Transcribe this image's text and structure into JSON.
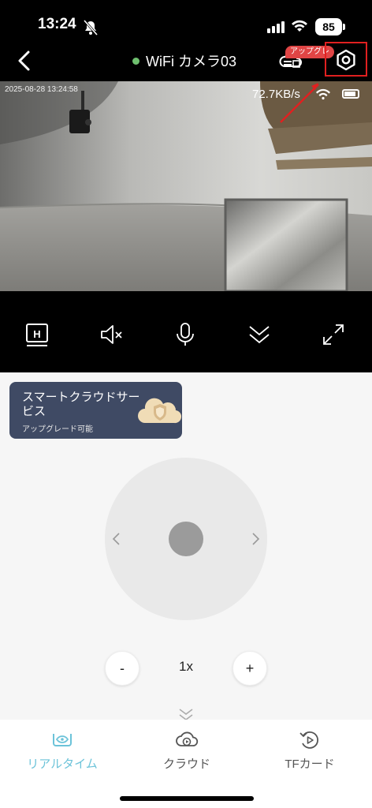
{
  "status_bar": {
    "time": "13:24",
    "battery": "85"
  },
  "header": {
    "title": "WiFi カメラ03",
    "upgrade_badge": "アップグレ"
  },
  "video": {
    "timestamp": "2025-08-28  13:24:58",
    "speed": "72.7KB/s"
  },
  "controls": {
    "hd_label": "H"
  },
  "promo": {
    "title": "スマートクラウドサービス",
    "subtitle": "アップグレード可能"
  },
  "zoom": {
    "minus": "-",
    "value": "1x",
    "plus": "+"
  },
  "tabs": [
    {
      "label": "リアルタイム",
      "active": true
    },
    {
      "label": "クラウド",
      "active": false
    },
    {
      "label": "TFカード",
      "active": false
    }
  ],
  "colors": {
    "active_tab": "#6cc3d9",
    "inactive_tab": "#555555",
    "promo_bg": "#3f4a64",
    "highlight_box": "#e02020"
  }
}
